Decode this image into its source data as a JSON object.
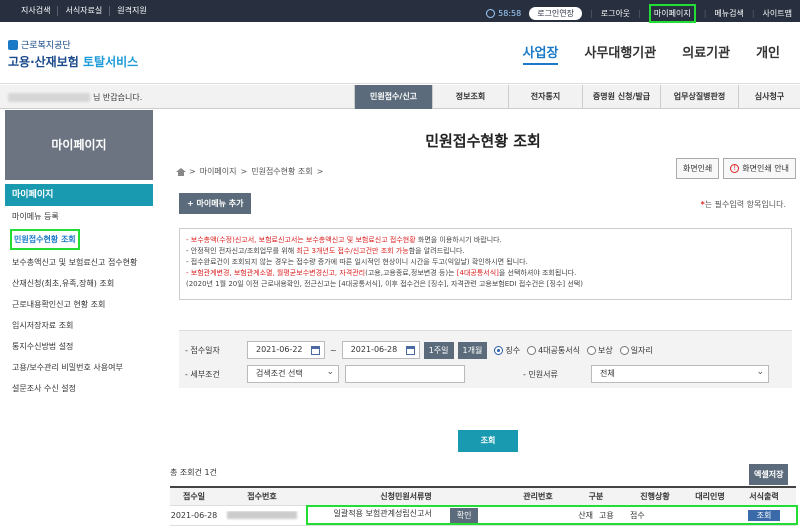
{
  "topbar": {
    "left": [
      "지사검색",
      "서식자료실",
      "원격지원"
    ],
    "timer": "58:58",
    "extend": "로그인연장",
    "logout": "로그아웃",
    "mypage": "마이페이지",
    "menu_search": "메뉴검색",
    "sitemap": "사이트맵"
  },
  "logo": {
    "org": "근로복지공단",
    "title_a": "고용·산재보험",
    "title_b": "토탈서비스"
  },
  "mainnav": [
    "사업장",
    "사무대행기관",
    "의료기관",
    "개인"
  ],
  "welcome_suffix": "님 반갑습니다.",
  "subtabs": [
    "민원접수/신고",
    "정보조회",
    "전자통지",
    "증명원 신청/발급",
    "업무상질병판정",
    "심사청구"
  ],
  "sidebar": {
    "head": "마이페이지",
    "title": "마이페이지",
    "items": [
      "마이메뉴 등록",
      "민원접수현황 조회",
      "보수총액신고 및 보험료신고 접수현황",
      "산재신청(최초,유족,장해) 조회",
      "근로내용확인신고 현황 조회",
      "임시저장자료 조회",
      "통지수신방법 설정",
      "고용/보수관리 비밀번호 사용여부",
      "설문조사 수신 설정"
    ]
  },
  "content": {
    "title": "민원접수현황 조회",
    "breadcrumb": [
      "마이페이지",
      "민원접수현황 조회"
    ],
    "print": "화면인쇄",
    "print_guide": "화면인쇄 안내",
    "add_menu": "+ 마이메뉴 추가",
    "required_note": "는 필수입력 항목입니다."
  },
  "notice": {
    "line1_red": "- 보수총액(수정)신고서, 보험료신고서는 보수총액신고 및 보험료신고 접수현황",
    "line1_rest": " 화면을 이용하시기 바랍니다.",
    "line2_a": "- 안정적인 전자신고/조회업무를 위해 ",
    "line2_red": "최근 3개년도 접수/신고건만 조회 가능",
    "line2_b": "함을 알려드립니다.",
    "line3": "- 접수완료건이 조회되지 않는 경우는 접수량 증가에 따른 일시적인 현상이니 시간을 두고(익일날) 확인하시면 됩니다.",
    "line4_red": "- 보험관계변경, 보험관계소멸, 월평균보수변경신고, 자격관리",
    "line4_b": "(고용,고용종료,정보변경 등)는 ",
    "line4_red2": "[4대공통서식]",
    "line4_c": "을 선택하셔야 조회됩니다.",
    "line5": "(2020년 1월 20일 이전 근로내용확인, 전근신고는 [4대공통서식], 이후 접수건은 [징수], 자격관련 고용보험EDI 접수건은 [징수] 선택)"
  },
  "search": {
    "date_label": "- 접수일자",
    "date_from": "2021-06-22",
    "date_to": "2021-06-28",
    "week_btn": "1주일",
    "month_btn": "1개월",
    "radios": [
      "징수",
      "4대공통서식",
      "보상",
      "일자리"
    ],
    "detail_label": "- 세부조건",
    "detail_value": "검색조건 선택",
    "doc_label": "- 민원서류",
    "doc_value": "전체",
    "button": "조회"
  },
  "results": {
    "total": "총 조회건 1건",
    "excel": "엑셀저장",
    "headers": [
      "접수일",
      "접수번호",
      "신청민원서류명",
      "관리번호",
      "구분",
      "진행상황",
      "대리인명",
      "서식출력"
    ],
    "row": {
      "date": "2021-06-28",
      "doc": "일괄적용 보험관계성립신고서",
      "confirm": "확인",
      "type": "산재",
      "type2": "고용",
      "status": "접수",
      "print": "조회"
    }
  }
}
